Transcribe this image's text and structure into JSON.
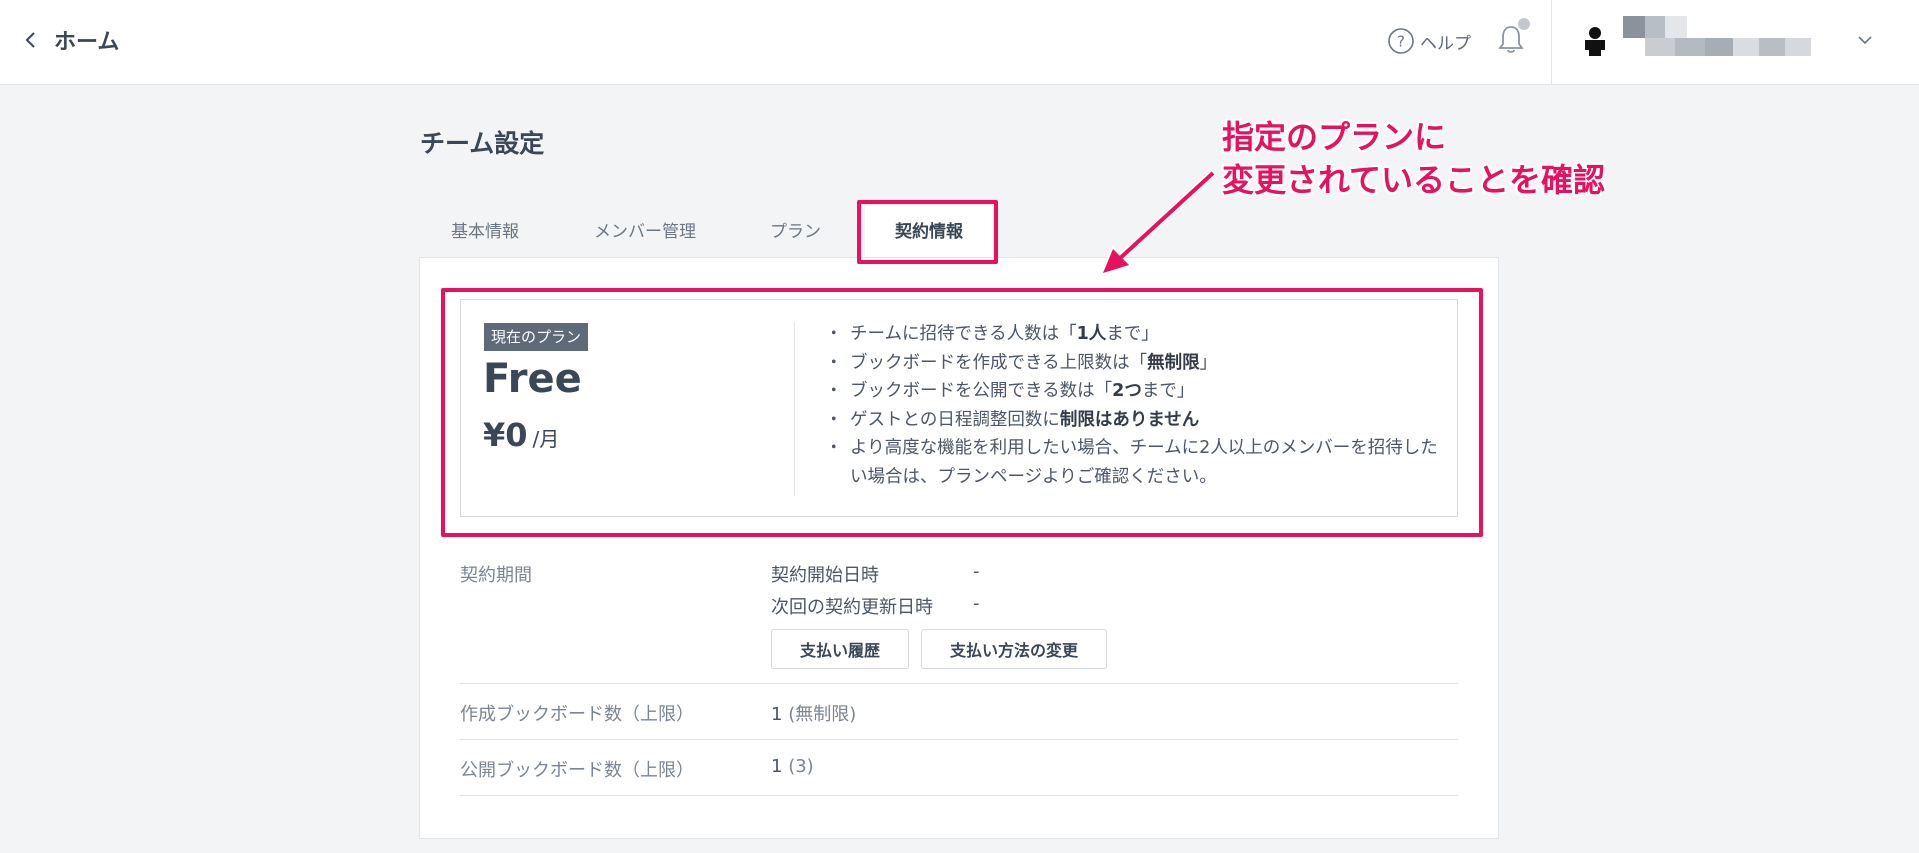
{
  "header": {
    "back_label": "ホーム",
    "help_label": "ヘルプ"
  },
  "page": {
    "title": "チーム設定"
  },
  "tabs": [
    {
      "label": "基本情報",
      "active": false
    },
    {
      "label": "メンバー管理",
      "active": false
    },
    {
      "label": "プラン",
      "active": false
    },
    {
      "label": "契約情報",
      "active": true
    }
  ],
  "plan": {
    "badge": "現在のプラン",
    "name": "Free",
    "price": "¥0",
    "price_unit": "/月",
    "features": [
      {
        "pre": "チームに招待できる人数は「",
        "bold": "1人",
        "post": "まで」"
      },
      {
        "pre": "ブックボードを作成できる上限数は「",
        "bold": "無制限",
        "post": "」"
      },
      {
        "pre": "ブックボードを公開できる数は「",
        "bold": "2つ",
        "post": "まで」"
      },
      {
        "pre": "ゲストとの日程調整回数に",
        "bold": "制限はありません",
        "post": ""
      },
      {
        "pre": "より高度な機能を利用したい場合、チームに2人以上のメンバーを招待したい場合は、プランページよりご確認ください。",
        "bold": "",
        "post": ""
      }
    ]
  },
  "contract": {
    "period_label": "契約期間",
    "start_label": "契約開始日時",
    "start_value": "-",
    "renewal_label": "次回の契約更新日時",
    "renewal_value": "-",
    "history_button": "支払い履歴",
    "payment_button": "支払い方法の変更"
  },
  "limits": {
    "created_label": "作成ブックボード数（上限）",
    "created_value": "1",
    "created_limit": "(無制限)",
    "public_label": "公開ブックボード数（上限）",
    "public_value": "1",
    "public_limit": "(3)"
  },
  "annotation": {
    "line1": "指定のプランに",
    "line2": "変更されていることを確認",
    "color": "#e8115f"
  }
}
